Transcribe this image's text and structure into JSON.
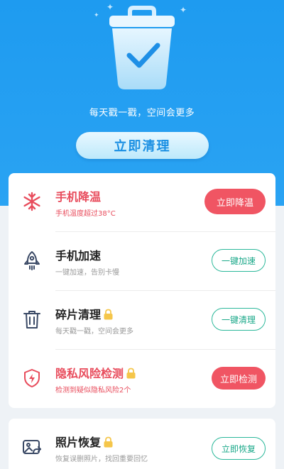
{
  "header": {
    "slogan": "每天戳一戳，空间会更多",
    "clean_button": "立即清理",
    "colors": {
      "hero": "#2aa3f3",
      "accent": "#1a8fe3"
    }
  },
  "items": [
    {
      "icon": "snowflake-icon",
      "title": "手机降温",
      "subtitle": "手机温度超过38°C",
      "action": "立即降温",
      "style": "alert",
      "locked": false
    },
    {
      "icon": "rocket-icon",
      "title": "手机加速",
      "subtitle": "一键加速，告别卡慢",
      "action": "一键加速",
      "style": "normal",
      "locked": false
    },
    {
      "icon": "trash-icon",
      "title": "碎片清理",
      "subtitle": "每天戳一戳，空间会更多",
      "action": "一键清理",
      "style": "normal",
      "locked": true
    },
    {
      "icon": "shield-icon",
      "title": "隐私风险检测",
      "subtitle": "检测到疑似隐私风险2个",
      "action": "立即检测",
      "style": "alert",
      "locked": true
    },
    {
      "icon": "photo-icon",
      "title": "照片恢复",
      "subtitle": "恢复误删照片，找回重要回忆",
      "action": "立即恢复",
      "style": "normal",
      "locked": true
    }
  ],
  "colors": {
    "alert": "#e84c5c",
    "green": "#2bb89a",
    "red_button": "#f05563"
  }
}
